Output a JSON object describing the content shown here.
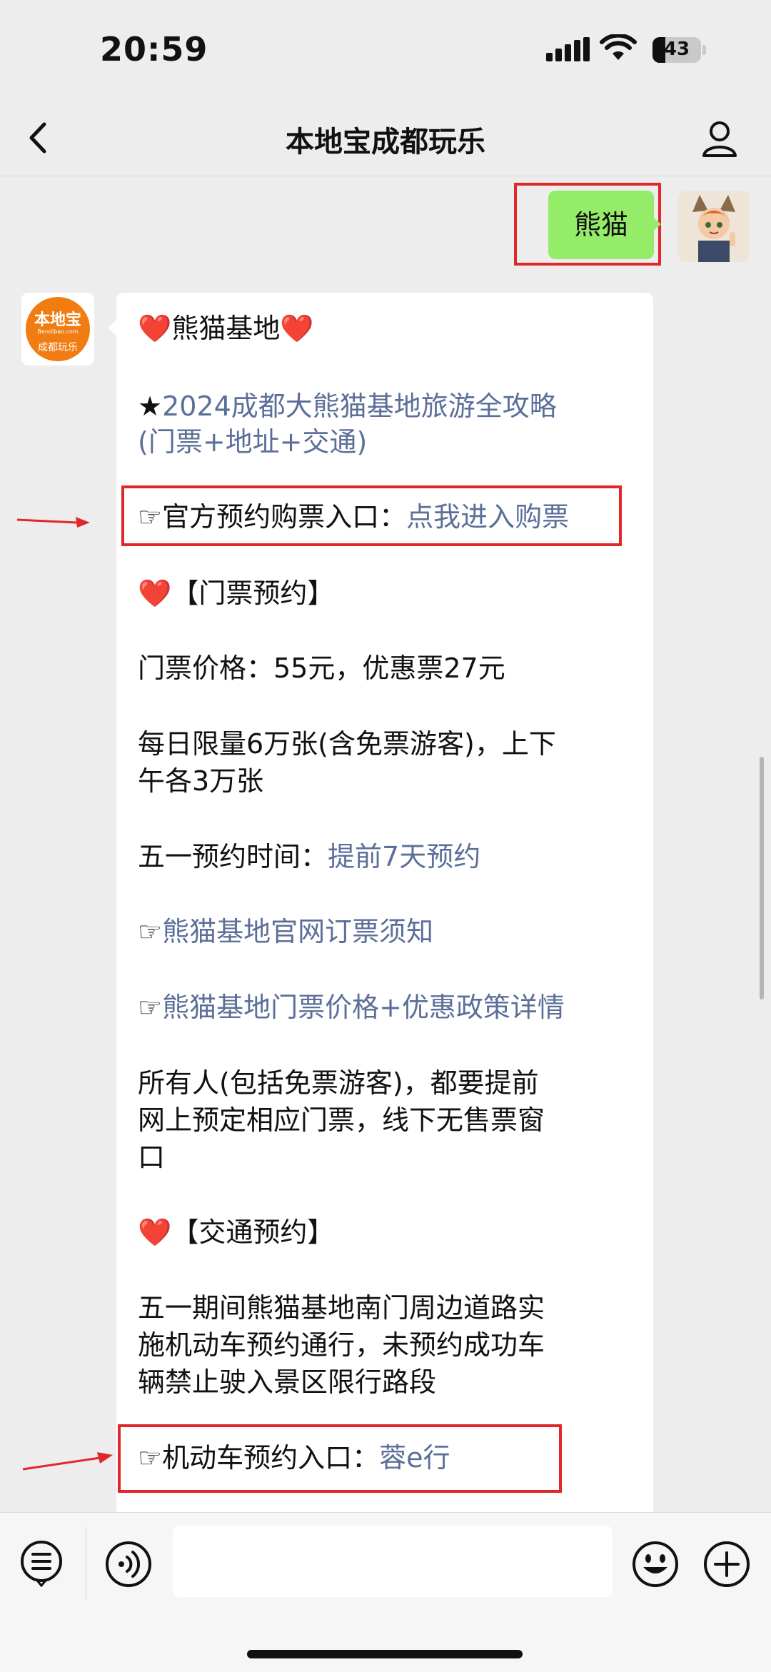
{
  "status_bar": {
    "time": "20:59",
    "battery": "43"
  },
  "nav": {
    "title": "本地宝成都玩乐"
  },
  "user_message": {
    "text": "熊猫"
  },
  "bot_avatar": {
    "logo_main": "本地宝",
    "logo_domain": "Bendibao.com",
    "logo_sub": "成都玩乐"
  },
  "message": {
    "heading": {
      "heart": "❤️",
      "title": "熊猫基地"
    },
    "guide_star": "★",
    "guide_line1": "2024成都大熊猫基地旅游全攻略",
    "guide_line2": "(门票+地址+交通)",
    "ticket_entry": {
      "hand": "☞",
      "label": "官方预约购票入口：",
      "link": "点我进入购票"
    },
    "ticket_section": "【门票预约】",
    "price": "门票价格：55元，优惠票27元",
    "daily_line1": "每日限量6万张(含免票游客)，上下",
    "daily_line2": "午各3万张",
    "may_label": "五一预约时间：",
    "may_link": "提前7天预约",
    "notice_link": "熊猫基地官网订票须知",
    "policy_link": "熊猫基地门票价格+优惠政策详情",
    "all_line1": "所有人(包括免票游客)，都要提前",
    "all_line2": "网上预定相应门票，线下无售票窗",
    "all_line3": "口",
    "traffic_section": "【交通预约】",
    "traffic_line1": "五一期间熊猫基地南门周边道路实",
    "traffic_line2": "施机动车预约通行，未预约成功车",
    "traffic_line3": "辆禁止驶入景区限行路段",
    "vehicle_label": "机动车预约入口：",
    "vehicle_link": "蓉e行"
  },
  "colors": {
    "link": "#5c6f99",
    "highlight": "#e0282b",
    "user_bubble": "#95ec69",
    "brand": "#f07c12"
  },
  "icons": [
    "signal-icon",
    "wifi-icon",
    "battery-icon",
    "back-icon",
    "profile-icon",
    "menu-icon",
    "voice-icon",
    "emoji-icon",
    "add-icon"
  ]
}
